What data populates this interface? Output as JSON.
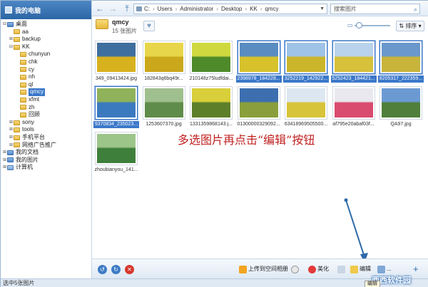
{
  "sidebar": {
    "title": "我的电脑",
    "tree": [
      {
        "label": "桌面",
        "level": 0,
        "toggle": "⊟",
        "icon": "blue"
      },
      {
        "label": "aa",
        "level": 1,
        "toggle": "",
        "icon": "folder"
      },
      {
        "label": "backup",
        "level": 1,
        "toggle": "⊞",
        "icon": "folder"
      },
      {
        "label": "KK",
        "level": 1,
        "toggle": "⊟",
        "icon": "folder"
      },
      {
        "label": "chunyun",
        "level": 2,
        "toggle": "",
        "icon": "folder"
      },
      {
        "label": "chk",
        "level": 2,
        "toggle": "",
        "icon": "folder"
      },
      {
        "label": "cy",
        "level": 2,
        "toggle": "",
        "icon": "folder"
      },
      {
        "label": "nh",
        "level": 2,
        "toggle": "",
        "icon": "folder"
      },
      {
        "label": "ql",
        "level": 2,
        "toggle": "",
        "icon": "folder"
      },
      {
        "label": "qmcy",
        "level": 2,
        "toggle": "",
        "icon": "folder",
        "selected": true
      },
      {
        "label": "xfmt",
        "level": 2,
        "toggle": "",
        "icon": "folder"
      },
      {
        "label": "zh",
        "level": 2,
        "toggle": "",
        "icon": "folder"
      },
      {
        "label": "回顾",
        "level": 2,
        "toggle": "",
        "icon": "folder"
      },
      {
        "label": "sony",
        "level": 1,
        "toggle": "⊞",
        "icon": "folder"
      },
      {
        "label": "tools",
        "level": 1,
        "toggle": "⊞",
        "icon": "folder"
      },
      {
        "label": "手机平台",
        "level": 1,
        "toggle": "⊞",
        "icon": "folder"
      },
      {
        "label": "网络广告推广",
        "level": 1,
        "toggle": "⊞",
        "icon": "folder"
      },
      {
        "label": "我的文档",
        "level": 0,
        "toggle": "⊞",
        "icon": "blue"
      },
      {
        "label": "我的图片",
        "level": 0,
        "toggle": "⊞",
        "icon": "blue"
      },
      {
        "label": "计算机",
        "level": 0,
        "toggle": "⊞",
        "icon": "pc"
      }
    ]
  },
  "path": {
    "segments": [
      "C:",
      "Users",
      "Administrator",
      "Desktop",
      "KK",
      "qmcy"
    ],
    "separator": "›"
  },
  "search": {
    "placeholder": "搜索图片"
  },
  "folder": {
    "name": "qmcy",
    "count": "15 张图片"
  },
  "sort_label": "排序",
  "thumbnails": [
    {
      "caption": "349_09413424.jpg",
      "selected": false,
      "sky": "#3f6f9e",
      "ground": "#d8b21e"
    },
    {
      "caption": "182843q6bq49r...",
      "selected": false,
      "sky": "#e8d64a",
      "ground": "#caa71b"
    },
    {
      "caption": "210148z75ludfdai...",
      "selected": false,
      "sky": "#cfd93f",
      "ground": "#4e8a2a"
    },
    {
      "caption": "2398978_184228...",
      "selected": true,
      "sky": "#5a8cc2",
      "ground": "#d7c22c"
    },
    {
      "caption": "3252219_142922...",
      "selected": true,
      "sky": "#9fc3e6",
      "ground": "#cbb52a"
    },
    {
      "caption": "5252423_184421...",
      "selected": true,
      "sky": "#b9d3ec",
      "ground": "#d7c03a"
    },
    {
      "caption": "8205317_222359...",
      "selected": true,
      "sky": "#6a98cc",
      "ground": "#c8b43a"
    },
    {
      "caption": "9370834_235023...",
      "selected": true,
      "sky": "#8fb25a",
      "ground": "#3c7ac0"
    },
    {
      "caption": "1253607370.jpg",
      "selected": false,
      "sky": "#9fbf8e",
      "ground": "#5f8c4a"
    },
    {
      "caption": "1331359868143.j...",
      "selected": false,
      "sky": "#d8cf3a",
      "ground": "#5d7f2a"
    },
    {
      "caption": "01300000329092...",
      "selected": false,
      "sky": "#3d6fb0",
      "ground": "#8a9f3c"
    },
    {
      "caption": "63418969505500...",
      "selected": false,
      "sky": "#dce7f2",
      "ground": "#d8c43a"
    },
    {
      "caption": "af795e20abaf03f...",
      "selected": false,
      "sky": "#e8e8ee",
      "ground": "#d94b6f"
    },
    {
      "caption": "QA97.jpg",
      "selected": false,
      "sky": "#6b9ad3",
      "ground": "#4f7f3a"
    },
    {
      "caption": "zhoubianyou_141...",
      "selected": false,
      "sky": "#9cc58a",
      "ground": "#3f7f3c"
    }
  ],
  "annotation": "多选图片再点击“编辑”按钮",
  "bottom": {
    "upload_label": "上传到空间相册",
    "beautify_label": "美化",
    "edit_label": "编辑",
    "more_label": "...",
    "tooltip": "编辑"
  },
  "status": "选中5张图片",
  "watermark": "西西软件园"
}
